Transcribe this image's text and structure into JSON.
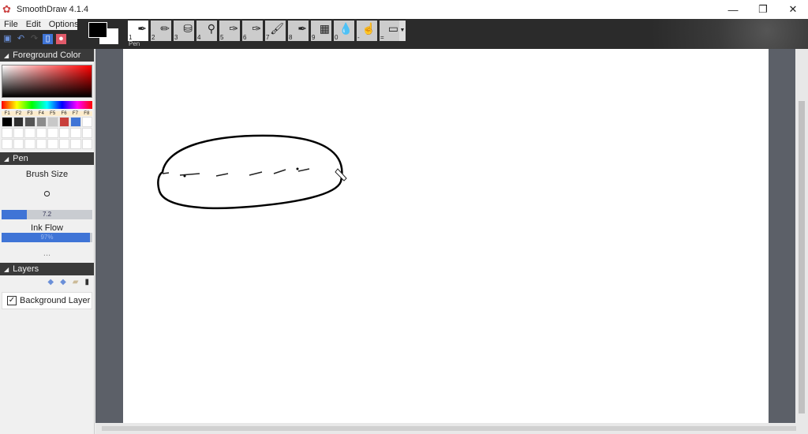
{
  "app": {
    "title": "SmoothDraw 4.1.4"
  },
  "menu": [
    "File",
    "Edit",
    "Options"
  ],
  "toolbar": {
    "active_tool_label": "Pen",
    "tools": [
      {
        "n": "1",
        "icon": "pen-icon"
      },
      {
        "n": "2",
        "icon": "pencil-icon"
      },
      {
        "n": "3",
        "icon": "bucket-icon"
      },
      {
        "n": "4",
        "icon": "eyedropper-icon"
      },
      {
        "n": "5",
        "icon": "airbrush-icon"
      },
      {
        "n": "6",
        "icon": "spray-icon"
      },
      {
        "n": "7",
        "icon": "brush-icon"
      },
      {
        "n": "8",
        "icon": "ink-brush-icon"
      },
      {
        "n": "9",
        "icon": "grain-icon"
      },
      {
        "n": "0",
        "icon": "water-icon"
      },
      {
        "n": "-",
        "icon": "smudge-icon"
      },
      {
        "n": "=",
        "icon": "eraser-icon"
      }
    ]
  },
  "panels": {
    "foreground": {
      "title": "Foreground Color",
      "fkeys": [
        "F1",
        "F2",
        "F3",
        "F4",
        "F5",
        "F6",
        "F7",
        "F8"
      ],
      "swatches": [
        "#000000",
        "#2f2f2f",
        "#555555",
        "#8c8c8c",
        "#c8c8c8",
        "#c8403c",
        "#3f74d6",
        "#ffffff"
      ]
    },
    "pen": {
      "title": "Pen",
      "brush_size_label": "Brush Size",
      "brush_size": "7.2",
      "brush_size_fraction": 0.28,
      "ink_flow_label": "Ink Flow",
      "ink_flow": "97%",
      "ink_flow_fraction": 0.97,
      "more": "..."
    },
    "layers": {
      "title": "Layers",
      "items": [
        {
          "name": "Background Layer",
          "visible": true
        }
      ]
    }
  }
}
